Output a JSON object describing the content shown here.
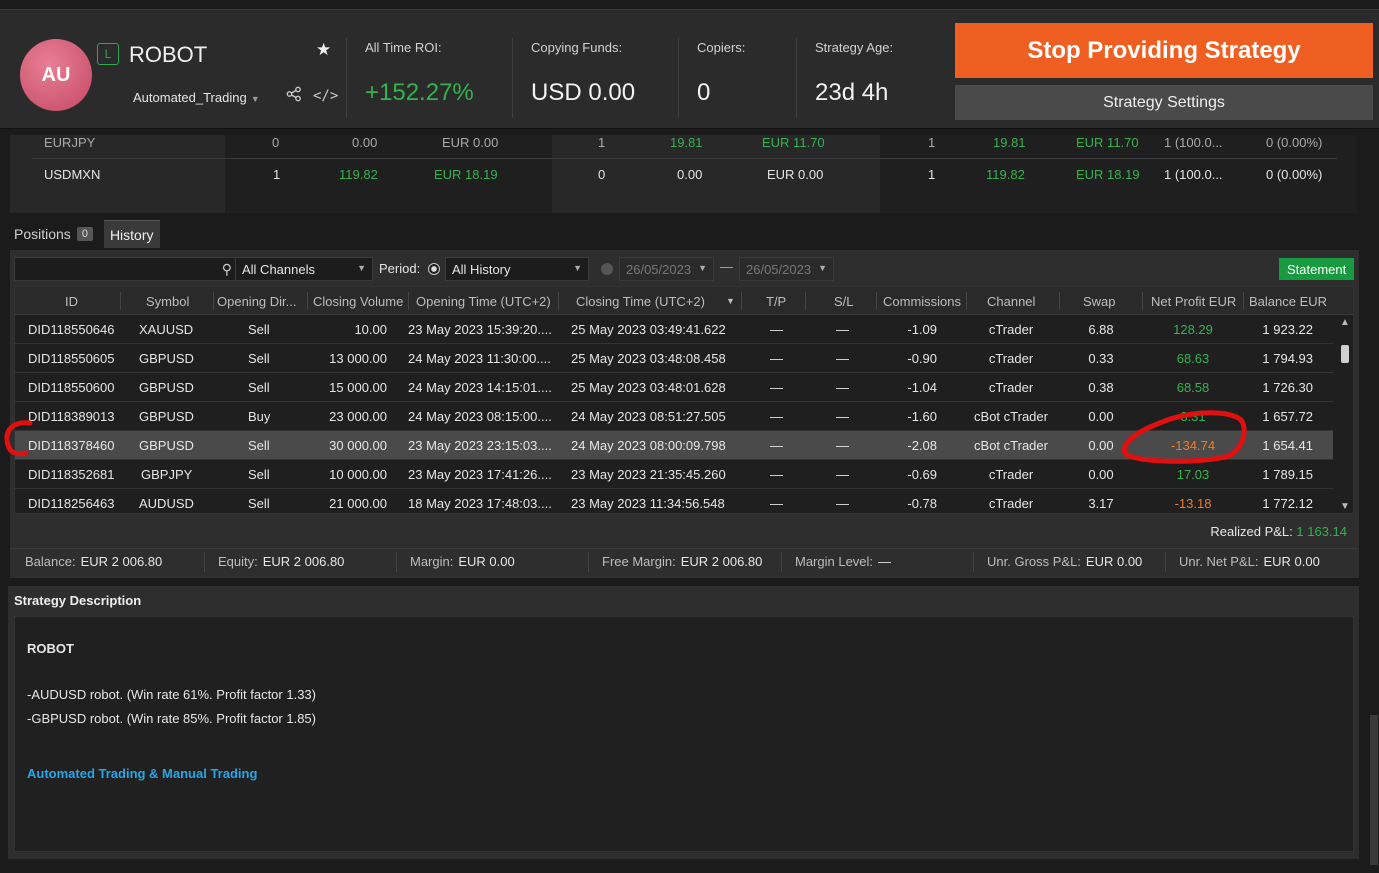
{
  "header": {
    "avatar": "AU",
    "badge": "L",
    "name": "ROBOT",
    "account": "Automated_Trading",
    "stats": [
      {
        "label": "All Time ROI:",
        "value": "+152.27%"
      },
      {
        "label": "Copying Funds:",
        "value": "USD 0.00"
      },
      {
        "label": "Copiers:",
        "value": "0"
      },
      {
        "label": "Strategy Age:",
        "value": "23d 4h"
      }
    ],
    "stop_label": "Stop Providing Strategy",
    "settings_label": "Strategy Settings",
    "colors": {
      "accent": "#ef5f22",
      "profit": "#33b24d"
    }
  },
  "summary": {
    "partial_row": [
      "EURJPY",
      "0",
      "0.00",
      "EUR 0.00",
      "1",
      "19.81",
      "EUR 11.70",
      "1",
      "19.81",
      "EUR 11.70",
      "1 (100.0...",
      "0 (0.00%)"
    ],
    "row": [
      "USDMXN",
      "1",
      "119.82",
      "EUR 18.19",
      "0",
      "0.00",
      "EUR 0.00",
      "1",
      "119.82",
      "EUR 18.19",
      "1 (100.0...",
      "0 (0.00%)"
    ]
  },
  "tabs": [
    {
      "label": "Positions",
      "count": "0"
    },
    {
      "label": "History"
    }
  ],
  "filters": {
    "channels": "All Channels",
    "period_label": "Period:",
    "period": "All History",
    "date_from": "26/05/2023",
    "date_dash": "—",
    "date_to": "26/05/2023",
    "statement_label": "Statement"
  },
  "columns": [
    "ID",
    "Symbol",
    "Opening Dir...",
    "Closing Volume",
    "Opening Time (UTC+2)",
    "Closing Time (UTC+2)",
    "T/P",
    "S/L",
    "Commissions",
    "Channel",
    "Swap",
    "Net Profit EUR",
    "Balance EUR"
  ],
  "rows": [
    {
      "id": "DID118550646",
      "symbol": "XAUUSD",
      "dir": "Sell",
      "vol": "10.00",
      "open": "23 May 2023 15:39:20....",
      "close": "25 May 2023 03:49:41.622",
      "tp": "—",
      "sl": "—",
      "comm": "-1.09",
      "channel": "cTrader",
      "swap": "6.88",
      "profit": "128.29",
      "balance": "1 923.22"
    },
    {
      "id": "DID118550605",
      "symbol": "GBPUSD",
      "dir": "Sell",
      "vol": "13 000.00",
      "open": "24 May 2023 11:30:00....",
      "close": "25 May 2023 03:48:08.458",
      "tp": "—",
      "sl": "—",
      "comm": "-0.90",
      "channel": "cTrader",
      "swap": "0.33",
      "profit": "68.63",
      "balance": "1 794.93"
    },
    {
      "id": "DID118550600",
      "symbol": "GBPUSD",
      "dir": "Sell",
      "vol": "15 000.00",
      "open": "24 May 2023 14:15:01....",
      "close": "25 May 2023 03:48:01.628",
      "tp": "—",
      "sl": "—",
      "comm": "-1.04",
      "channel": "cTrader",
      "swap": "0.38",
      "profit": "68.58",
      "balance": "1 726.30"
    },
    {
      "id": "DID118389013",
      "symbol": "GBPUSD",
      "dir": "Buy",
      "vol": "23 000.00",
      "open": "24 May 2023 08:15:00....",
      "close": "24 May 2023 08:51:27.505",
      "tp": "—",
      "sl": "—",
      "comm": "-1.60",
      "channel": "cBot cTrader",
      "swap": "0.00",
      "profit": "3.31",
      "balance": "1 657.72"
    },
    {
      "id": "DID118378460",
      "symbol": "GBPUSD",
      "dir": "Sell",
      "vol": "30 000.00",
      "open": "23 May 2023 23:15:03....",
      "close": "24 May 2023 08:00:09.798",
      "tp": "—",
      "sl": "—",
      "comm": "-2.08",
      "channel": "cBot cTrader",
      "swap": "0.00",
      "profit": "-134.74",
      "balance": "1 654.41"
    },
    {
      "id": "DID118352681",
      "symbol": "GBPJPY",
      "dir": "Sell",
      "vol": "10 000.00",
      "open": "23 May 2023 17:41:26....",
      "close": "23 May 2023 21:35:45.260",
      "tp": "—",
      "sl": "—",
      "comm": "-0.69",
      "channel": "cTrader",
      "swap": "0.00",
      "profit": "17.03",
      "balance": "1 789.15"
    },
    {
      "id": "DID118256463",
      "symbol": "AUDUSD",
      "dir": "Sell",
      "vol": "21 000.00",
      "open": "18 May 2023 17:48:03....",
      "close": "23 May 2023 11:34:56.548",
      "tp": "—",
      "sl": "—",
      "comm": "-0.78",
      "channel": "cTrader",
      "swap": "3.17",
      "profit": "-13.18",
      "balance": "1 772.12"
    }
  ],
  "realized": {
    "label": "Realized P&L:",
    "value": "1 163.14"
  },
  "balance_bar": [
    {
      "label": "Balance:",
      "value": "EUR 2 006.80"
    },
    {
      "label": "Equity:",
      "value": "EUR 2 006.80"
    },
    {
      "label": "Margin:",
      "value": "EUR 0.00"
    },
    {
      "label": "Free Margin:",
      "value": "EUR 2 006.80"
    },
    {
      "label": "Margin Level:",
      "value": "—"
    },
    {
      "label": "Unr. Gross P&L:",
      "value": "EUR 0.00"
    },
    {
      "label": "Unr. Net P&L:",
      "value": "EUR 0.00"
    }
  ],
  "description": {
    "title": "Strategy Description",
    "heading": "ROBOT",
    "lines": [
      "-AUDUSD robot. (Win rate 61%. Profit factor 1.33)",
      "-GBPUSD robot. (Win rate 85%. Profit factor 1.85)"
    ],
    "link": "Automated Trading & Manual Trading"
  }
}
